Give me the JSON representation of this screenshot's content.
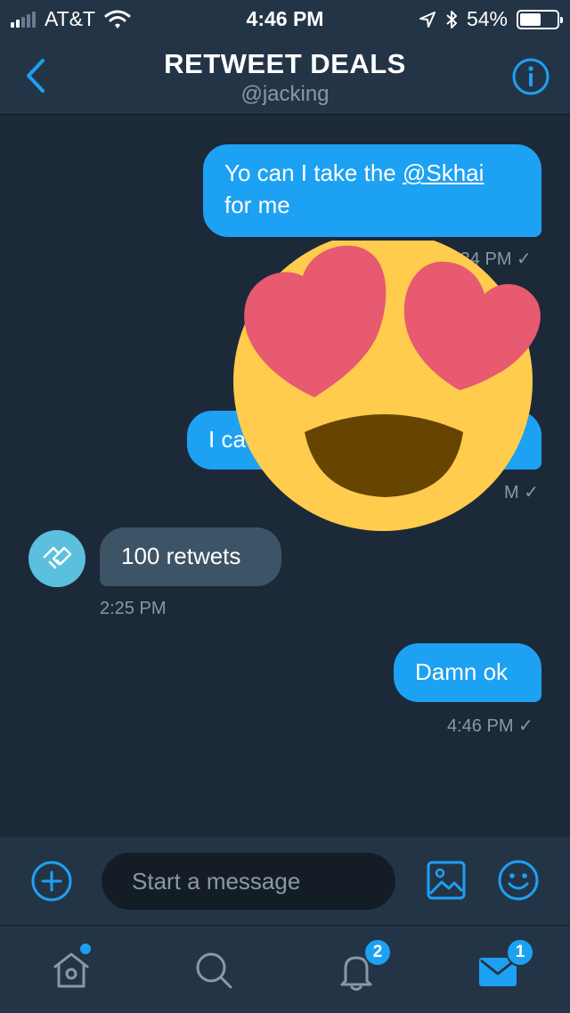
{
  "status_bar": {
    "carrier": "AT&T",
    "time": "4:46 PM",
    "battery": "54%",
    "battery_level": 0.54,
    "icons": [
      "signal-icon",
      "wifi-icon",
      "location-arrow-icon",
      "bluetooth-icon",
      "battery-icon"
    ]
  },
  "header": {
    "title": "RETWEET DEALS",
    "handle": "@jacking",
    "back_icon": "chevron-left-icon",
    "info_icon": "info-icon"
  },
  "messages": [
    {
      "direction": "out",
      "text_before": "Yo can I take the ",
      "mention": "@Skhai",
      "text_after": "for me",
      "time": "2:34 PM",
      "check": "✓"
    },
    {
      "direction": "out",
      "text": "I ca",
      "time": "M",
      "check": "✓"
    },
    {
      "direction": "in",
      "text": "100 retwets",
      "time": "2:25 PM"
    },
    {
      "direction": "out",
      "text": "Damn ok",
      "time": "4:46 PM",
      "check": "✓"
    }
  ],
  "composer": {
    "placeholder": "Start a message",
    "icons": [
      "add-icon",
      "image-icon",
      "emoji-icon"
    ]
  },
  "tabs": [
    {
      "name": "home",
      "icon": "home-icon",
      "has_dot": true
    },
    {
      "name": "search",
      "icon": "search-icon"
    },
    {
      "name": "notifications",
      "icon": "bell-icon",
      "badge": "2"
    },
    {
      "name": "messages",
      "icon": "mail-icon",
      "badge": "1",
      "active": true
    }
  ],
  "colors": {
    "background": "#1c2938",
    "bar": "#243447",
    "accent": "#1da1f2",
    "incoming_bubble": "#3d5466",
    "muted": "#8899a6",
    "emoji_face": "#ffcc4d",
    "emoji_hearts": "#e75a70"
  }
}
